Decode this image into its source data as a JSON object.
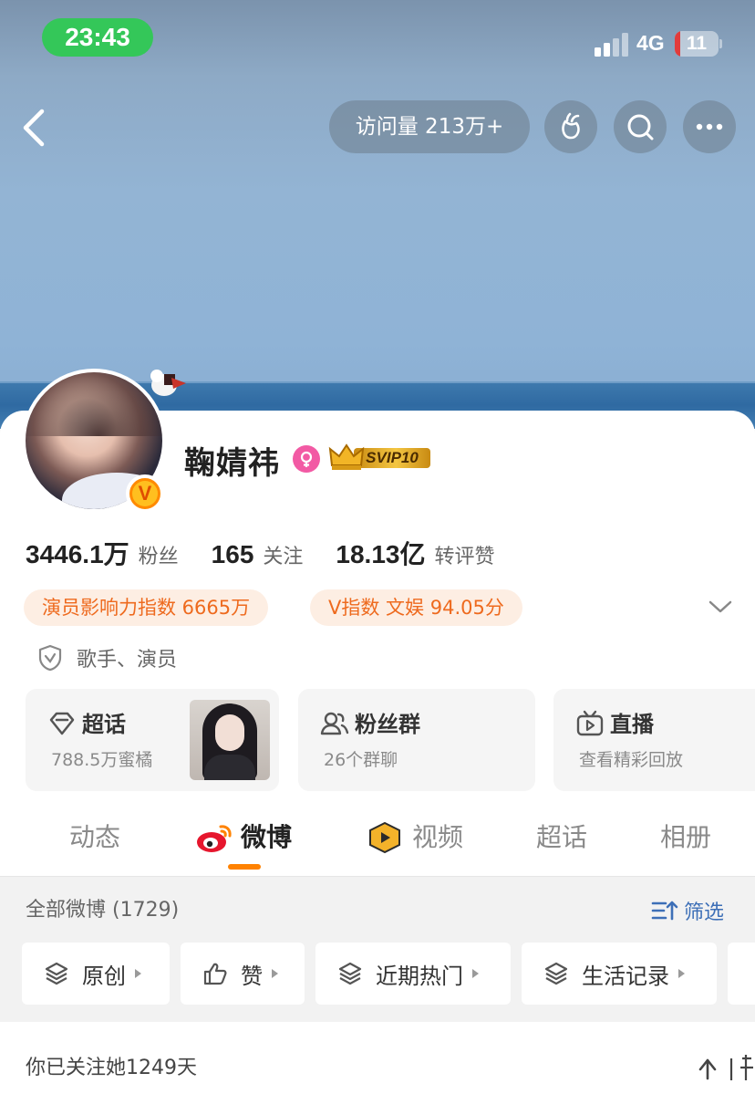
{
  "status_bar": {
    "time": "23:43",
    "network": "4G",
    "battery": "11"
  },
  "header": {
    "visits": "访问量 213万+"
  },
  "profile": {
    "name": "鞠婧祎",
    "verified_badge": "V",
    "svip": "SVIP10",
    "stats": [
      {
        "value": "3446.1万",
        "label": "粉丝"
      },
      {
        "value": "165",
        "label": "关注"
      },
      {
        "value": "18.13亿",
        "label": "转评赞"
      }
    ],
    "tags": [
      "演员影响力指数 6665万",
      "V指数 文娱 94.05分"
    ],
    "role": "歌手、演员"
  },
  "features": [
    {
      "title": "超话",
      "subtitle": "788.5万蜜橘",
      "icon": "diamond-icon"
    },
    {
      "title": "粉丝群",
      "subtitle": "26个群聊",
      "icon": "people-icon"
    },
    {
      "title": "直播",
      "subtitle": "查看精彩回放",
      "icon": "tv-icon"
    }
  ],
  "tabs": [
    "动态",
    "微博",
    "视频",
    "超话",
    "相册"
  ],
  "active_tab": "微博",
  "feed": {
    "title": "全部微博 (1729)",
    "filter_label": "筛选",
    "chips": [
      "原创",
      "赞",
      "近期热门",
      "生活记录"
    ]
  },
  "bottom": {
    "text": "你已关注她1249天"
  },
  "colors": {
    "accent": "#ff8200",
    "tag_text": "#ee6a1e",
    "link": "#3d6fb7",
    "status_green": "#34c759"
  }
}
